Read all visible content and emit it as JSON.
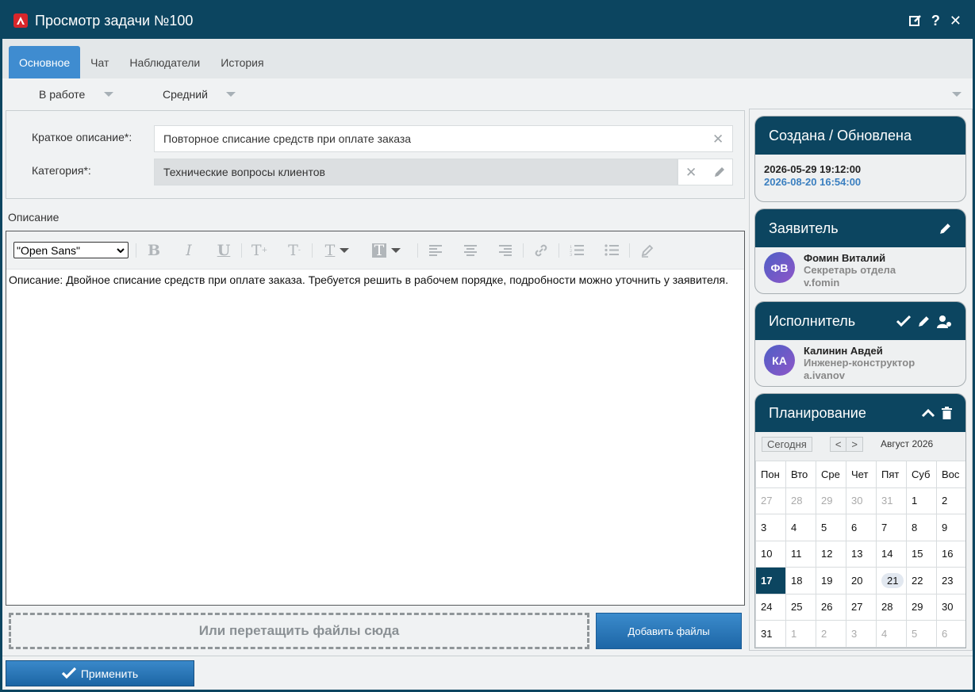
{
  "window": {
    "title": "Просмотр задачи №100"
  },
  "tabs": [
    {
      "label": "Основное"
    },
    {
      "label": "Чат"
    },
    {
      "label": "Наблюдатели"
    },
    {
      "label": "История"
    }
  ],
  "status": {
    "state": "В работе",
    "priority": "Средний"
  },
  "form": {
    "short_desc_label": "Краткое описание*:",
    "short_desc_value": "Повторное списание средств при оплате заказа",
    "category_label": "Категория*:",
    "category_value": "Технические вопросы клиентов"
  },
  "description": {
    "label": "Описание",
    "font": "\"Open Sans\"",
    "text": "Описание: Двойное списание средств при оплате заказа. Требуется решить в рабочем порядке, подробности можно уточнить у заявителя."
  },
  "files": {
    "drop_text": "Или перетащить файлы сюда",
    "add_label": "Добавить файлы"
  },
  "apply_label": "Применить",
  "created": {
    "title": "Создана / Обновлена",
    "created_at": "2026-05-29 19:12:00",
    "updated_at": "2026-08-20 16:54:00",
    "updated_color": "#3a7fc0"
  },
  "requester": {
    "title": "Заявитель",
    "initials": "ФВ",
    "name": "Фомин Виталий",
    "position": "Секретарь отдела",
    "login": "v.fomin"
  },
  "executor": {
    "title": "Исполнитель",
    "initials": "КА",
    "name": "Калинин Авдей",
    "position": "Инженер-конструктор",
    "login": "a.ivanov"
  },
  "planning": {
    "title": "Планирование",
    "today_label": "Сегодня",
    "prev_label": "<",
    "next_label": ">",
    "month": "Август 2026",
    "weekdays": [
      "Пон",
      "Вто",
      "Сре",
      "Чет",
      "Пят",
      "Суб",
      "Вос"
    ],
    "weeks": [
      [
        "27",
        "28",
        "29",
        "30",
        "31",
        "1",
        "2"
      ],
      [
        "3",
        "4",
        "5",
        "6",
        "7",
        "8",
        "9"
      ],
      [
        "10",
        "11",
        "12",
        "13",
        "14",
        "15",
        "16"
      ],
      [
        "17",
        "18",
        "19",
        "20",
        "21",
        "22",
        "23"
      ],
      [
        "24",
        "25",
        "26",
        "27",
        "28",
        "29",
        "30"
      ],
      [
        "31",
        "1",
        "2",
        "3",
        "4",
        "5",
        "6"
      ]
    ],
    "selected_day": "17",
    "today_day": "21"
  },
  "colors": {
    "header": "#0c4560",
    "accent": "#3f8cd0"
  }
}
